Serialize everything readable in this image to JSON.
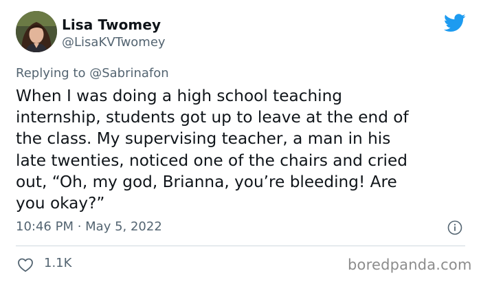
{
  "author": {
    "display_name": "Lisa Twomey",
    "handle": "@LisaKVTwomey"
  },
  "reply": {
    "prefix": "Replying to ",
    "to_handle": "@Sabrinafon"
  },
  "tweet": {
    "lines": [
      "When I was doing a high school teaching",
      "internship, students got up to leave at the end of",
      "the class. My supervising teacher, a man in his",
      "late twenties, noticed one of the chairs and cried",
      "out, “Oh, my god, Brianna, you’re bleeding! Are",
      "you okay?”"
    ],
    "timestamp": "10:46 PM · May 5, 2022"
  },
  "engagement": {
    "likes": "1.1K"
  },
  "watermark": "boredpanda.com",
  "icons": {
    "brand": "twitter-bird-icon",
    "info": "info-icon",
    "like": "heart-icon"
  },
  "colors": {
    "text_primary": "#0f1419",
    "text_secondary": "#536471",
    "twitter_blue": "#1d9bf0",
    "divider": "#cfd9de",
    "watermark": "#8c8c8c"
  }
}
